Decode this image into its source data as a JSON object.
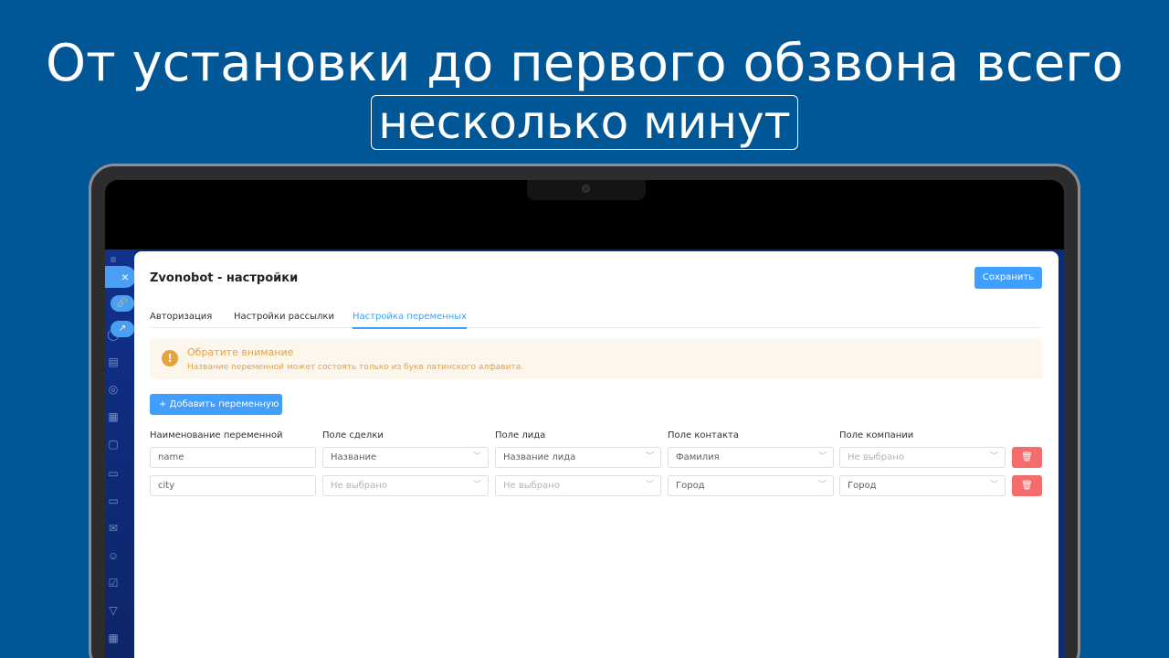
{
  "headline": {
    "line1": "От установки до первого обзвона всего",
    "line2": "несколько минут"
  },
  "sidebar": {
    "close_icon": "×",
    "link_icon": "🔗",
    "open_icon": "↗"
  },
  "panel": {
    "title": "Zvonobot - настройки",
    "save_label": "Сохранить",
    "tabs": [
      "Авторизация",
      "Настройки рассылки",
      "Настройка переменных"
    ],
    "active_tab": 2,
    "alert": {
      "title": "Обратите внимание",
      "description": "Название переменной может состоять только из букв латинского алфавита.",
      "icon": "!"
    },
    "add_label": "+ Добавить переменную",
    "columns": [
      "Наименование переменной",
      "Поле сделки",
      "Поле лида",
      "Поле контакта",
      "Поле компании"
    ],
    "rows": [
      {
        "name": "name",
        "deal": "Название",
        "lead": "Название лида",
        "contact": "Фамилия",
        "company": "Не выбрано"
      },
      {
        "name": "city",
        "deal": "Не выбрано",
        "lead": "Не выбрано",
        "contact": "Город",
        "company": "Город"
      }
    ]
  },
  "colors": {
    "background": "#015695",
    "accent": "#409eff",
    "danger": "#f56c6c",
    "warning": "#e6a23c"
  }
}
